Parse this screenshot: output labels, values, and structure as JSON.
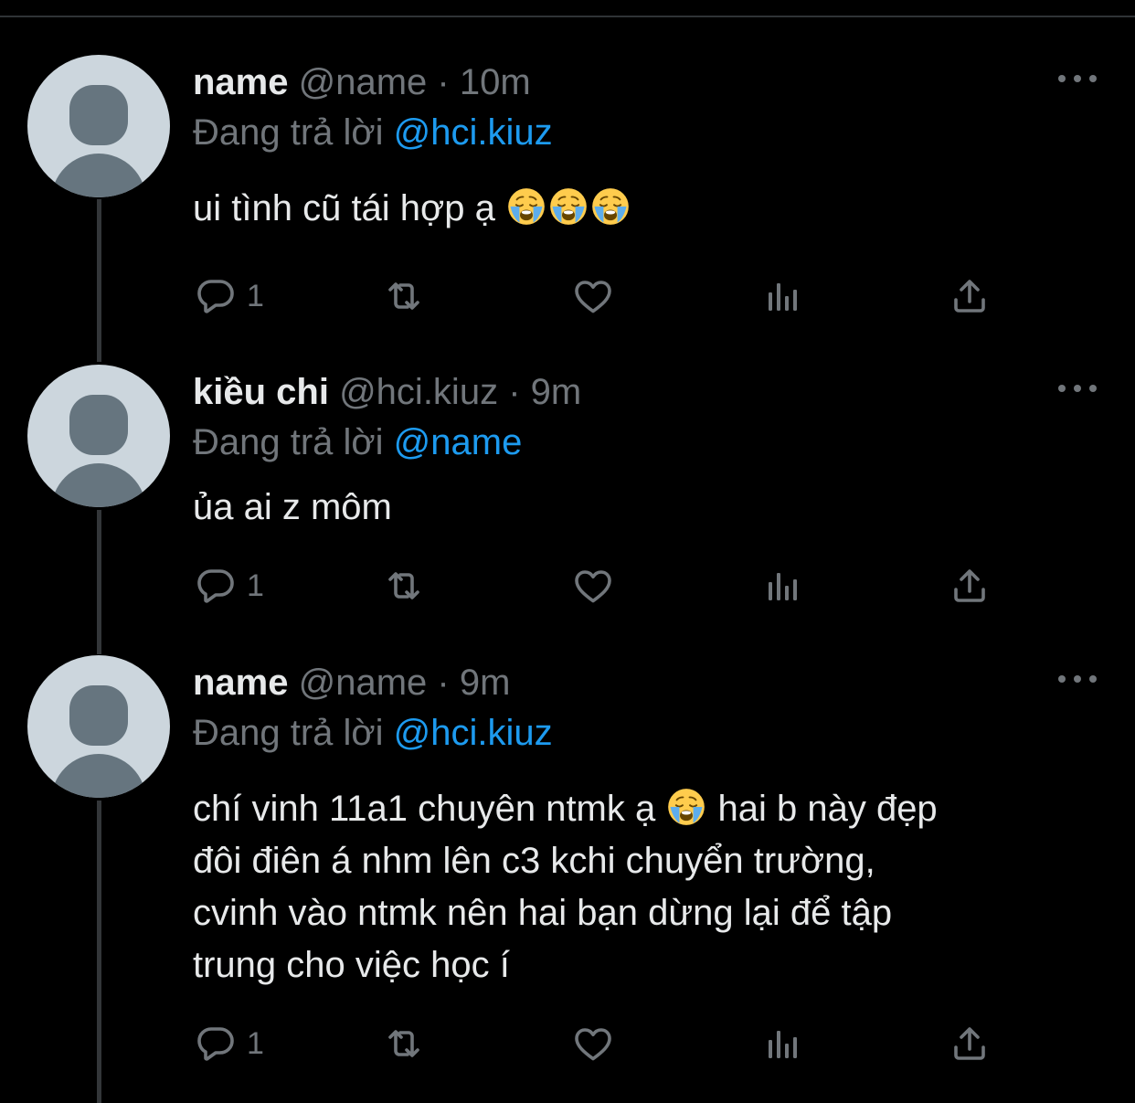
{
  "colors": {
    "background": "#000000",
    "text": "#e7e9ea",
    "muted": "#71767b",
    "mention": "#1d9bf0",
    "thread_line": "#333639",
    "avatar_bg": "#ccd6dd",
    "avatar_fg": "#66757f"
  },
  "tweets": [
    {
      "name": "name",
      "handle": "@name",
      "separator": "·",
      "time": "10m",
      "reply_prefix": "Đang trả lời",
      "reply_to": "@hci.kiuz",
      "text": "ui tình cũ tái hợp ạ",
      "emoji_count": 3,
      "emoji": "loudly-crying-face",
      "reply_count": "1",
      "icons": [
        "reply-icon",
        "retweet-icon",
        "like-icon",
        "analytics-icon",
        "share-icon"
      ]
    },
    {
      "name": "kiều chi",
      "handle": "@hci.kiuz",
      "separator": "·",
      "time": "9m",
      "reply_prefix": "Đang trả lời",
      "reply_to": "@name",
      "text": "ủa ai z môm",
      "reply_count": "1",
      "icons": [
        "reply-icon",
        "retweet-icon",
        "like-icon",
        "analytics-icon",
        "share-icon"
      ]
    },
    {
      "name": "name",
      "handle": "@name",
      "separator": "·",
      "time": "9m",
      "reply_prefix": "Đang trả lời",
      "reply_to": "@hci.kiuz",
      "text_line1_a": "chí vinh 11a1 chuyên ntmk ạ",
      "text_line1_b": "hai b này đẹp",
      "text_line2": "đôi điên á nhm lên c3 kchi chuyển trường,",
      "text_line3": "cvinh vào ntmk nên hai bạn dừng lại để tập",
      "text_line4": "trung cho việc học í",
      "emoji": "loudly-crying-face",
      "reply_count": "1",
      "icons": [
        "reply-icon",
        "retweet-icon",
        "like-icon",
        "analytics-icon",
        "share-icon"
      ]
    }
  ]
}
